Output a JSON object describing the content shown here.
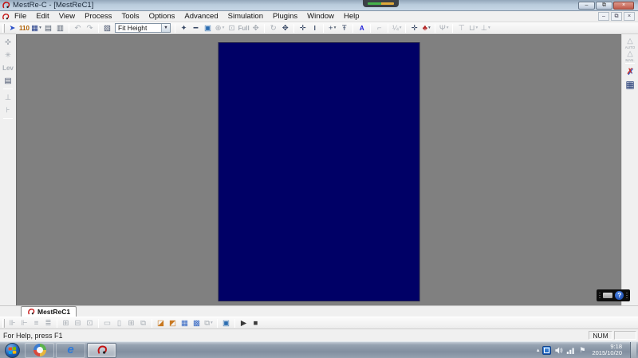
{
  "titlebar": {
    "title": "MestRe-C - [MestReC1]",
    "minimize": "–",
    "restore": "⧉",
    "close": "×"
  },
  "mdi": {
    "minimize": "–",
    "restore": "⧉",
    "close": "×"
  },
  "menus": [
    "File",
    "Edit",
    "View",
    "Process",
    "Tools",
    "Options",
    "Advanced",
    "Simulation",
    "Plugins",
    "Window",
    "Help"
  ],
  "toolbar_top": {
    "items_a": [
      {
        "n": "open-icon",
        "g": "➤",
        "c": "#2b50c8"
      },
      {
        "n": "new-fid-icon",
        "g": "110",
        "c": "#b06000",
        "txt": 1
      },
      {
        "n": "save-icon",
        "g": "▦",
        "c": "#27408b",
        "dd": 1
      },
      {
        "n": "print-icon",
        "g": "▤",
        "c": "#556070"
      },
      {
        "n": "print-preview-icon",
        "g": "▥",
        "c": "#556070"
      },
      {
        "sep": 1
      },
      {
        "n": "undo-icon",
        "g": "↶",
        "dis": 1
      },
      {
        "n": "redo-icon",
        "g": "↷",
        "dis": 1
      },
      {
        "sep": 1
      },
      {
        "n": "zoom-mode-icon",
        "g": "▨",
        "c": "#44506a"
      }
    ],
    "combo": {
      "value": "Fit Height",
      "arrow": "▼"
    },
    "items_b": [
      {
        "sep": 1
      },
      {
        "n": "expand-icon",
        "g": "✦",
        "c": "#3a4a66"
      },
      {
        "n": "reduce-icon",
        "g": "━",
        "c": "#3a4a66"
      },
      {
        "n": "fullscreen-icon",
        "g": "▣",
        "c": "#2b6cb0"
      },
      {
        "n": "zoom-icon",
        "g": "⊕",
        "dis": 1,
        "dd": 1
      },
      {
        "n": "zoom-box-icon",
        "g": "⊡",
        "dis": 1
      },
      {
        "n": "full-label",
        "g": "Full",
        "dis": 1,
        "txt": 1
      },
      {
        "n": "pan-icon",
        "g": "✥",
        "dis": 1
      },
      {
        "sep": 1
      },
      {
        "n": "rotate-icon",
        "g": "↻",
        "dis": 1
      },
      {
        "n": "move-icon",
        "g": "✥",
        "c": "#3a4a66"
      },
      {
        "sep": 1
      },
      {
        "n": "crosshair-icon",
        "g": "✛",
        "c": "#3a4a66"
      },
      {
        "n": "integral-icon",
        "g": "I",
        "c": "#3a4a66",
        "txt": 1
      },
      {
        "sep": 1
      },
      {
        "n": "add-peak-icon",
        "g": "+",
        "c": "#3a4a66",
        "dd": 1
      },
      {
        "n": "peak-pick-icon",
        "g": "Ŧ",
        "c": "#3a4a66"
      },
      {
        "sep": 1
      },
      {
        "n": "text-tool-icon",
        "g": "A",
        "c": "#1a1ad8",
        "txt": 1
      },
      {
        "sep": 1
      },
      {
        "n": "angle-icon",
        "g": "⌐",
        "dis": 1
      },
      {
        "sep": 1
      },
      {
        "n": "fraction-icon",
        "g": "¼",
        "dis": 1,
        "dd": 1
      },
      {
        "sep": 1
      },
      {
        "n": "divider-icon",
        "g": "✛",
        "c": "#3a4a66"
      },
      {
        "n": "tree-icon",
        "g": "♣",
        "c": "#b22222",
        "dd": 1
      },
      {
        "sep": 1
      },
      {
        "n": "process-tools-icon",
        "g": "Ψ",
        "dis": 1,
        "dd": 1
      },
      {
        "sep": 1
      },
      {
        "n": "axis-top-icon",
        "g": "⊤",
        "dis": 1
      },
      {
        "n": "cut-region-icon",
        "g": "⊔",
        "dis": 1,
        "dd": 1
      },
      {
        "n": "axis-bottom-icon",
        "g": "⊥",
        "dis": 1,
        "dd": 1
      }
    ]
  },
  "left_tools": [
    {
      "n": "peak-cursor-icon",
      "g": "✜",
      "dis": 1
    },
    {
      "n": "contour-icon",
      "g": "✳",
      "dis": 1
    },
    {
      "n": "levels-icon",
      "g": "Lev",
      "dis": 1,
      "txt": 1
    },
    {
      "n": "level-table-icon",
      "g": "▤",
      "c": "#44506a"
    },
    {
      "sep": 1
    },
    {
      "n": "axes-icon",
      "g": "⊥",
      "dis": 1
    },
    {
      "n": "trace-icon",
      "g": "⊦",
      "dis": 1
    },
    {
      "sep": 1
    }
  ],
  "right_tools": {
    "auto": {
      "n": "auto-assign-icon",
      "g": "△",
      "lbl": "AUTO"
    },
    "manual": {
      "n": "manual-assign-icon",
      "g": "△",
      "lbl": "MAN."
    },
    "repair": {
      "n": "repair-tools-icon",
      "g": "✗"
    },
    "table": {
      "n": "assignment-table-icon",
      "g": "▦"
    }
  },
  "workspace": {
    "canvas_color": "#808080",
    "page_color": "#000066"
  },
  "capture_widget": {
    "help_glyph": "?"
  },
  "tabs": [
    {
      "label": "MestReC1"
    }
  ],
  "toolbar_bottom": {
    "items": [
      {
        "n": "align-left-icon",
        "g": "⊪",
        "dis": 1
      },
      {
        "n": "align-right-icon",
        "g": "⊩",
        "dis": 1
      },
      {
        "n": "distribute-h-icon",
        "g": "≡",
        "dis": 1
      },
      {
        "n": "distribute-v-icon",
        "g": "≣",
        "dis": 1
      },
      {
        "sep": 1
      },
      {
        "n": "tile-horizontal-icon",
        "g": "⊞",
        "dis": 1
      },
      {
        "n": "tile-vertical-icon",
        "g": "⊟",
        "dis": 1
      },
      {
        "n": "cascade-icon",
        "g": "⊡",
        "dis": 1
      },
      {
        "sep": 1
      },
      {
        "n": "fit-width-icon",
        "g": "▭",
        "dis": 1
      },
      {
        "n": "fit-height-icon",
        "g": "▯",
        "dis": 1
      },
      {
        "n": "grid-icon",
        "g": "⊞",
        "dis": 1
      },
      {
        "n": "windows-icon",
        "g": "⧉",
        "dis": 1
      },
      {
        "sep": 1
      },
      {
        "n": "stack-plots-icon",
        "g": "◪",
        "c": "#c87820"
      },
      {
        "n": "unstack-plots-icon",
        "g": "◩",
        "c": "#c87820"
      },
      {
        "n": "overlay-table-icon",
        "g": "▦",
        "c": "#3a6bc4"
      },
      {
        "n": "overlay-grid-icon",
        "g": "▩",
        "c": "#3a6bc4"
      },
      {
        "n": "arrange-icon",
        "g": "⧉",
        "dis": 1,
        "dd": 1
      },
      {
        "sep": 1
      },
      {
        "n": "screen-view-icon",
        "g": "▣",
        "c": "#2b6cb0"
      },
      {
        "sep": 1
      },
      {
        "n": "play-icon",
        "g": "▶",
        "c": "#3a3a3a"
      },
      {
        "n": "stop-icon",
        "g": "■",
        "c": "#3a3a3a"
      }
    ]
  },
  "statusbar": {
    "message": "For Help, press F1",
    "num": "NUM"
  },
  "taskbar": {
    "time": "9:18",
    "date": "2015/10/20",
    "tray_arrow": "▴",
    "ie_glyph": "e"
  }
}
